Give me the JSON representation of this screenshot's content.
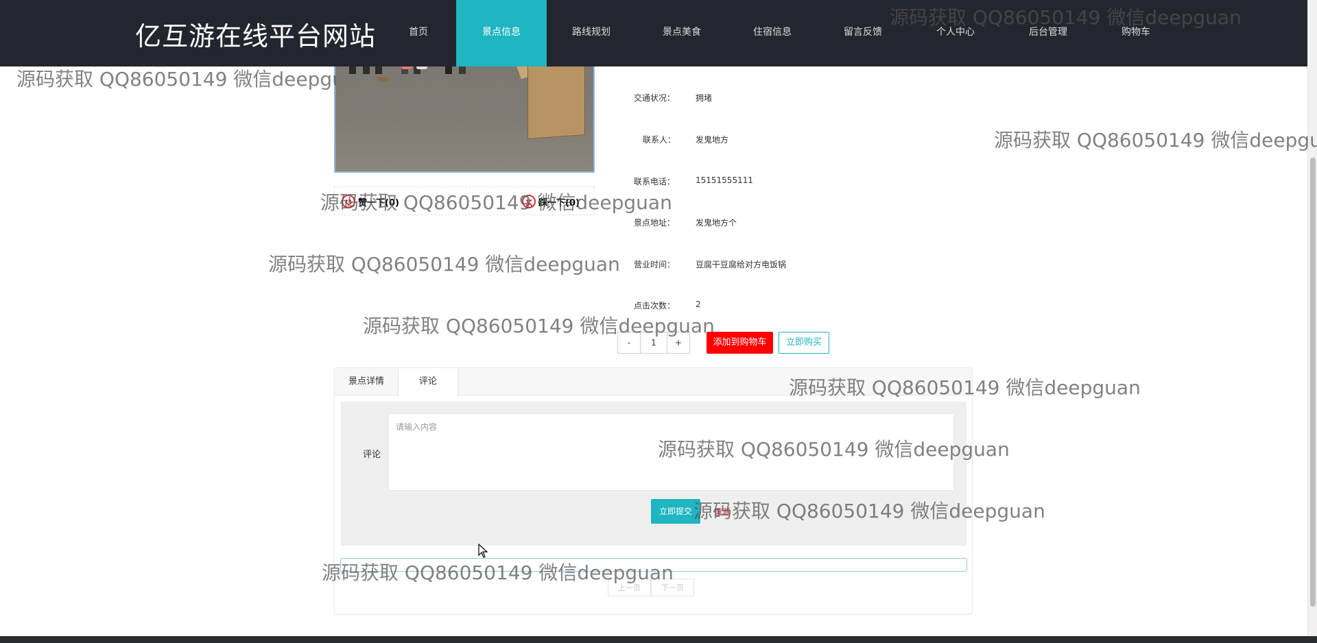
{
  "site": {
    "brand": "亿互游在线平台网站"
  },
  "nav": {
    "items": [
      "首页",
      "景点信息",
      "路线规划",
      "景点美食",
      "住宿信息",
      "留言反馈",
      "个人中心",
      "后台管理",
      "购物车"
    ],
    "active_index": 1
  },
  "like": {
    "up_label": "赞一下(0)",
    "down_label": "踩一下(0)"
  },
  "details": [
    {
      "label": "交通状况：",
      "value": "拥堵"
    },
    {
      "label": "联系人：",
      "value": "发鬼地方"
    },
    {
      "label": "联系电话：",
      "value": "15151555111"
    },
    {
      "label": "景点地址：",
      "value": "发鬼地方个"
    },
    {
      "label": "营业时间：",
      "value": "豆腐干豆腐给对方电饭锅"
    },
    {
      "label": "点击次数：",
      "value": "2"
    }
  ],
  "purchase": {
    "minus": "-",
    "quantity": "1",
    "plus": "+",
    "add_to_cart": "添加到购物车",
    "buy_now": "立即购买"
  },
  "tabs": {
    "items": [
      "景点详情",
      "评论"
    ],
    "active_index": 1
  },
  "comment_form": {
    "label": "评论",
    "placeholder": "请输入内容",
    "submit": "立即提交",
    "reset": "重置"
  },
  "pager": {
    "prev": "上一页",
    "next": "下一页"
  },
  "watermark": "源码获取 QQ86050149 微信deepguan",
  "colors": {
    "nav_bg": "#23262e",
    "accent": "#1fb5c1",
    "cart": "#ff0000"
  }
}
